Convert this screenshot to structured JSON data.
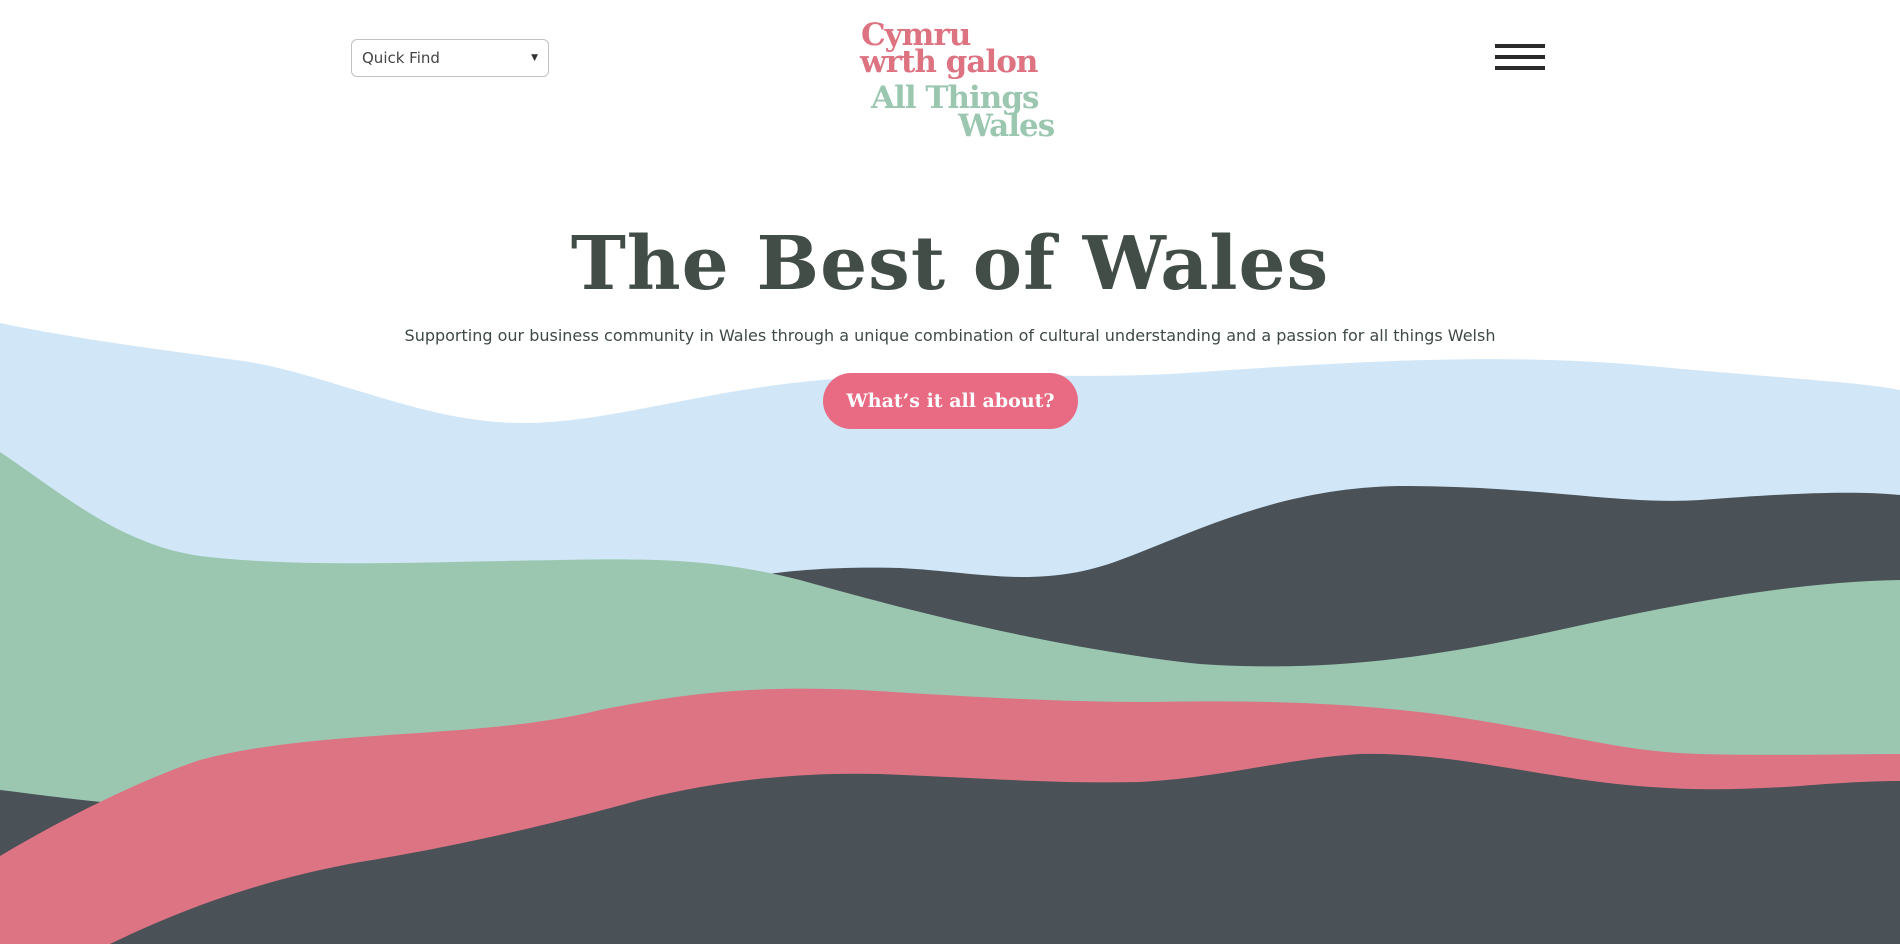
{
  "header": {
    "quick_find": {
      "label": "Quick Find",
      "arrow_icon": "caret-down-icon"
    },
    "logo": {
      "welsh_line_1": "Cymru",
      "welsh_line_2": "wrth galon",
      "english_line_1": "All Things",
      "english_line_2": "Wales"
    },
    "menu_icon": "hamburger-menu-icon"
  },
  "hero": {
    "title": "The Best of Wales",
    "subtitle": "Supporting our business community in Wales through a unique combination of cultural understanding and a passion for all things Welsh",
    "cta_label": "What’s it all about?"
  },
  "colors": {
    "sky": "#d1e7f7",
    "green": "#9bc7b0",
    "pink": "#dc7483",
    "slate": "#4a5157",
    "title_text": "#414d46",
    "button": "#e86a83"
  }
}
